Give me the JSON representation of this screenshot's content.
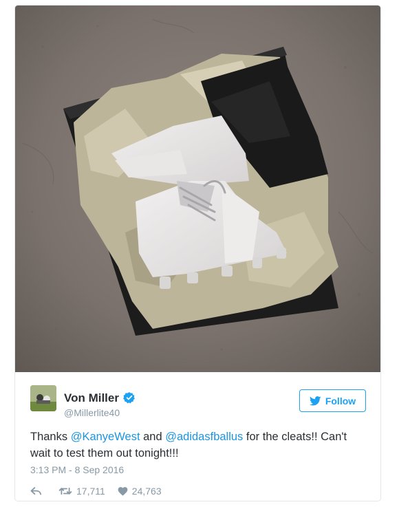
{
  "author": {
    "display_name": "Von Miller",
    "handle": "@Millerlite40"
  },
  "follow_button": {
    "label": "Follow"
  },
  "tweet": {
    "text_before": "Thanks ",
    "mention_1": "@KanyeWest",
    "text_middle": " and ",
    "mention_2": "@adidasfballus",
    "text_after": " for the cleats!! Can't wait to test them out tonight!!!",
    "timestamp": "3:13 PM - 8 Sep 2016"
  },
  "stats": {
    "retweets": "17,711",
    "likes": "24,763"
  },
  "colors": {
    "accent": "#1da1f2",
    "link": "#1b95e0",
    "muted": "#8899a6",
    "text": "#292f33"
  },
  "icons": {
    "verified": "verified-badge-icon",
    "follow": "twitter-bird-icon",
    "reply": "reply-arrow-icon",
    "retweet": "retweet-icon",
    "like": "heart-icon"
  }
}
